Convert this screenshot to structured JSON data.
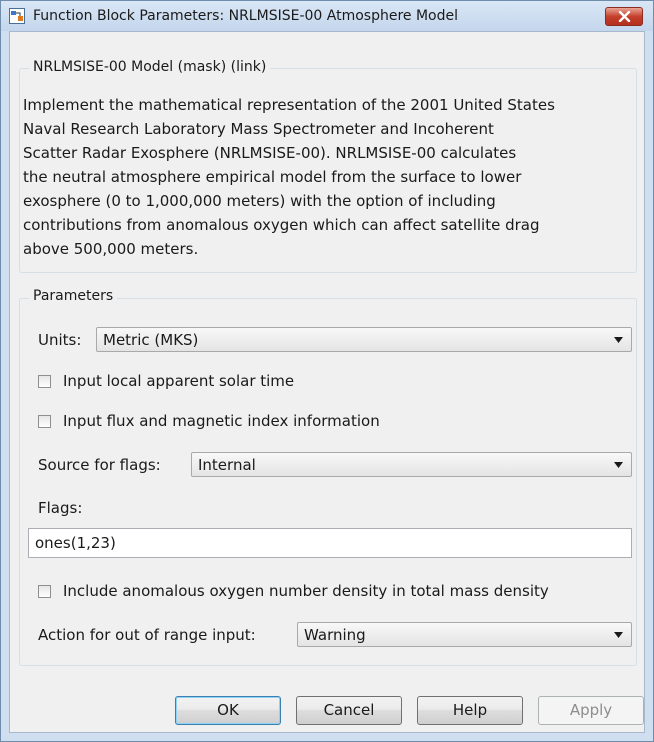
{
  "window": {
    "title": "Function Block Parameters: NRLMSISE-00 Atmosphere Model",
    "close_icon": "close-x-icon",
    "app_icon": "simulink-block-icon"
  },
  "description_group": {
    "legend": "NRLMSISE-00 Model (mask) (link)",
    "text": "Implement the mathematical representation of the 2001 United States\nNaval Research Laboratory Mass Spectrometer and Incoherent\nScatter Radar Exosphere (NRLMSISE-00). NRLMSISE-00 calculates\nthe neutral atmosphere empirical model from the surface to lower\nexosphere (0 to 1,000,000 meters) with the option of including\ncontributions from anomalous oxygen which can affect satellite drag\nabove 500,000 meters."
  },
  "parameters": {
    "legend": "Parameters",
    "units": {
      "label": "Units:",
      "value": "Metric (MKS)"
    },
    "input_solar_time": {
      "label": "Input local apparent solar time",
      "checked": false
    },
    "input_flux": {
      "label": "Input flux and magnetic index information",
      "checked": false
    },
    "source_for_flags": {
      "label": "Source for flags:",
      "value": "Internal"
    },
    "flags": {
      "label": "Flags:",
      "value": "ones(1,23)"
    },
    "anomalous_oxygen": {
      "label": "Include anomalous oxygen number density in total mass density",
      "checked": false
    },
    "out_of_range": {
      "label": "Action for out of range input:",
      "value": "Warning"
    }
  },
  "buttons": {
    "ok": "OK",
    "cancel": "Cancel",
    "help": "Help",
    "apply": "Apply"
  },
  "colors": {
    "titlebar": "#c4d6ec",
    "close_button": "#c4402c",
    "dialog_background": "#f0f0f0",
    "default_button_border": "#3c7fb1"
  }
}
